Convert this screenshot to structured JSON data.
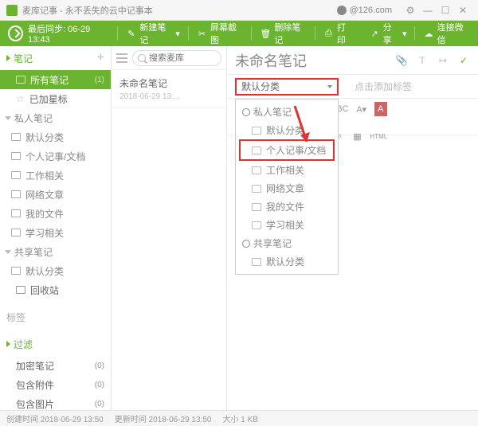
{
  "titlebar": {
    "app_title": "麦库记事 - 永不丢失的云中记事本",
    "user_email": "@126.com"
  },
  "toolbar": {
    "sync_label": "最后同步: 06-29 13:43",
    "new_note": "新建笔记",
    "screenshot": "屏幕截图",
    "delete": "删除笔记",
    "print": "打印",
    "share": "分享",
    "wechat": "连接微信"
  },
  "sidebar": {
    "notes_header": "笔记",
    "items": [
      {
        "label": "所有笔记",
        "count": "(1)"
      },
      {
        "label": "已加星标"
      },
      {
        "label": "私人笔记"
      },
      {
        "label": "默认分类"
      },
      {
        "label": "个人记事/文档"
      },
      {
        "label": "工作相关"
      },
      {
        "label": "网络文章"
      },
      {
        "label": "我的文件"
      },
      {
        "label": "学习相关"
      },
      {
        "label": "共享笔记"
      },
      {
        "label": "默认分类"
      },
      {
        "label": "回收站"
      }
    ],
    "section_tags": "标签",
    "section_filter": "过滤",
    "filter_items": [
      {
        "label": "加密笔记",
        "count": "(0)"
      },
      {
        "label": "包含附件",
        "count": "(0)"
      },
      {
        "label": "包含图片",
        "count": "(0)"
      }
    ]
  },
  "notelist": {
    "search_placeholder": "搜索麦库",
    "items": [
      {
        "title": "未命名笔记",
        "date": "2018-06-29 13:..."
      }
    ]
  },
  "editor": {
    "title": "未命名笔记",
    "category_selected": "默认分类",
    "tags_placeholder": "点击添加标签",
    "dropdown": {
      "group1": "私人笔记",
      "items1": [
        "默认分类",
        "个人记事/文档",
        "工作相关",
        "网络文章",
        "我的文件",
        "学习相关"
      ],
      "group2": "共享笔记",
      "items2": [
        "默认分类"
      ]
    }
  },
  "statusbar": {
    "created": "创建时间 2018-06-29 13:50",
    "modified": "更新时间 2018-06-29 13:50",
    "size": "大小 1 KB"
  }
}
